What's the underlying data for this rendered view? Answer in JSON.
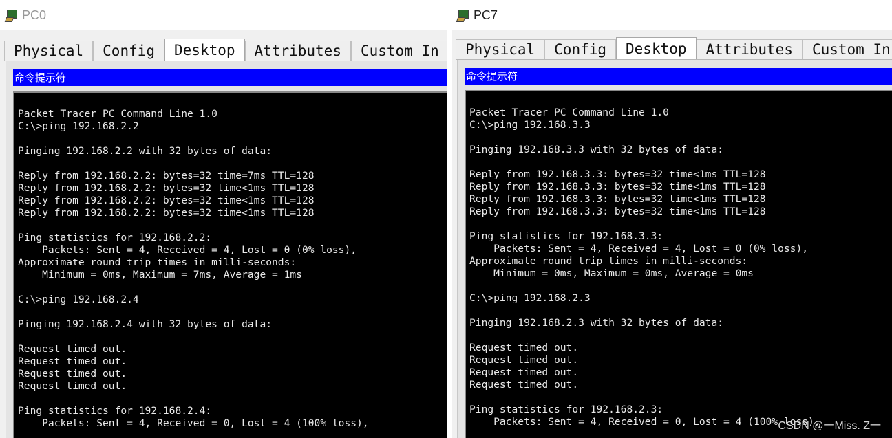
{
  "left": {
    "title": "PC0",
    "tabs": [
      "Physical",
      "Config",
      "Desktop",
      "Attributes",
      "Custom In"
    ],
    "active_tab": "Desktop",
    "cmd_title": "命令提示符",
    "lines": [
      "Packet Tracer PC Command Line 1.0",
      "C:\\>ping 192.168.2.2",
      "",
      "Pinging 192.168.2.2 with 32 bytes of data:",
      "",
      "Reply from 192.168.2.2: bytes=32 time=7ms TTL=128",
      "Reply from 192.168.2.2: bytes=32 time<1ms TTL=128",
      "Reply from 192.168.2.2: bytes=32 time<1ms TTL=128",
      "Reply from 192.168.2.2: bytes=32 time<1ms TTL=128",
      "",
      "Ping statistics for 192.168.2.2:",
      "    Packets: Sent = 4, Received = 4, Lost = 0 (0% loss),",
      "Approximate round trip times in milli-seconds:",
      "    Minimum = 0ms, Maximum = 7ms, Average = 1ms",
      "",
      "C:\\>ping 192.168.2.4",
      "",
      "Pinging 192.168.2.4 with 32 bytes of data:",
      "",
      "Request timed out.",
      "Request timed out.",
      "Request timed out.",
      "Request timed out.",
      "",
      "Ping statistics for 192.168.2.4:",
      "    Packets: Sent = 4, Received = 0, Lost = 4 (100% loss),"
    ]
  },
  "right": {
    "title": "PC7",
    "tabs": [
      "Physical",
      "Config",
      "Desktop",
      "Attributes",
      "Custom In"
    ],
    "active_tab": "Desktop",
    "cmd_title": "命令提示符",
    "lines": [
      "Packet Tracer PC Command Line 1.0",
      "C:\\>ping 192.168.3.3",
      "",
      "Pinging 192.168.3.3 with 32 bytes of data:",
      "",
      "Reply from 192.168.3.3: bytes=32 time<1ms TTL=128",
      "Reply from 192.168.3.3: bytes=32 time<1ms TTL=128",
      "Reply from 192.168.3.3: bytes=32 time<1ms TTL=128",
      "Reply from 192.168.3.3: bytes=32 time<1ms TTL=128",
      "",
      "Ping statistics for 192.168.3.3:",
      "    Packets: Sent = 4, Received = 4, Lost = 0 (0% loss),",
      "Approximate round trip times in milli-seconds:",
      "    Minimum = 0ms, Maximum = 0ms, Average = 0ms",
      "",
      "C:\\>ping 192.168.2.3",
      "",
      "Pinging 192.168.2.3 with 32 bytes of data:",
      "",
      "Request timed out.",
      "Request timed out.",
      "Request timed out.",
      "Request timed out.",
      "",
      "Ping statistics for 192.168.2.3:",
      "    Packets: Sent = 4, Received = 0, Lost = 4 (100% loss),"
    ]
  },
  "watermark": "CSDN @一Miss. Z一",
  "colors": {
    "cmd_title_bg": "#0000ff",
    "terminal_bg": "#000000",
    "terminal_fg": "#e8e8e8"
  }
}
